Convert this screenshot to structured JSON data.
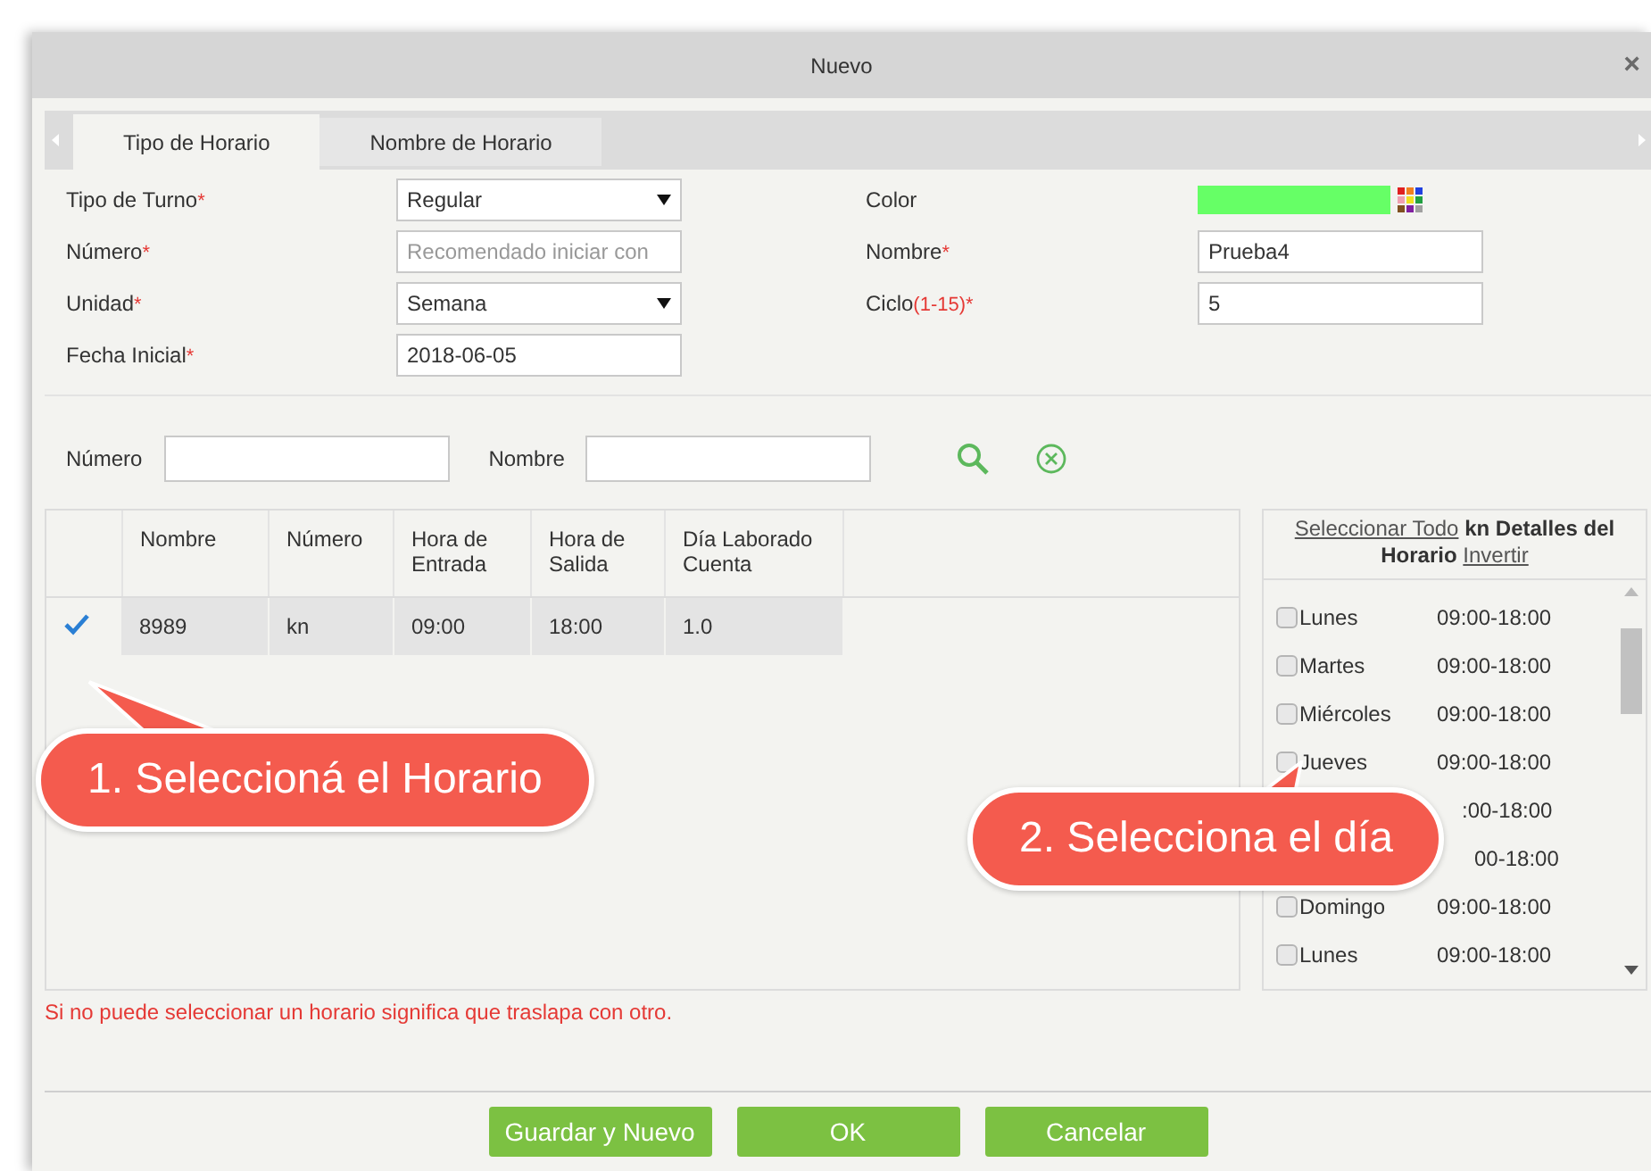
{
  "window": {
    "title": "Nuevo",
    "close": "×"
  },
  "tabs": [
    {
      "label": "Tipo de Horario",
      "selected": true
    },
    {
      "label": "Nombre de Horario",
      "selected": false
    }
  ],
  "form_left": [
    {
      "label": "Tipo de Turno",
      "mark": "*",
      "kind": "select",
      "value": "Regular"
    },
    {
      "label": "Número",
      "mark": "*",
      "kind": "input",
      "placeholder": "Recomendado iniciar con"
    },
    {
      "label": "Unidad",
      "mark": "*",
      "kind": "select",
      "value": "Semana"
    },
    {
      "label": "Fecha Inicial",
      "mark": "*",
      "kind": "input",
      "value": "2018-06-05"
    }
  ],
  "form_right": [
    {
      "label": "Color",
      "kind": "color",
      "color": "#66ff66"
    },
    {
      "label": "Nombre",
      "mark": "*",
      "kind": "input",
      "value": "Prueba4"
    },
    {
      "label": "Ciclo",
      "mark": "(1-15)*",
      "kind": "input",
      "value": "5"
    }
  ],
  "search": {
    "fields": [
      {
        "label": "Número"
      },
      {
        "label": "Nombre"
      }
    ]
  },
  "table": {
    "columns": [
      "Nombre",
      "Número",
      "Hora de Entrada",
      "Hora de Salida",
      "Día Laborado Cuenta"
    ],
    "rows": [
      {
        "selected": true,
        "cells": [
          "8989",
          "kn",
          "09:00",
          "18:00",
          "1.0"
        ]
      }
    ]
  },
  "days_panel": {
    "select_all": "Seleccionar Todo",
    "title": "kn Detalles del Horario",
    "invert": "Invertir",
    "rows": [
      {
        "day": "Lunes",
        "time": "09:00-18:00",
        "checked": false
      },
      {
        "day": "Martes",
        "time": "09:00-18:00",
        "checked": false
      },
      {
        "day": "Miércoles",
        "time": "09:00-18:00",
        "checked": false
      },
      {
        "day": "Jueves",
        "time": "09:00-18:00",
        "checked": false
      },
      {
        "time": ":00-18:00"
      },
      {
        "time": "00-18:00"
      },
      {
        "day": "Domingo",
        "time": "09:00-18:00",
        "checked": false
      },
      {
        "day": "Lunes",
        "time": "09:00-18:00",
        "checked": false
      }
    ]
  },
  "note": "Si no puede seleccionar un horario significa que traslapa con otro.",
  "buttons": [
    "Guardar y Nuevo",
    "OK",
    "Cancelar"
  ],
  "callouts": [
    {
      "text": "1. Seleccioná el Horario"
    },
    {
      "text": "2. Selecciona el día"
    }
  ]
}
